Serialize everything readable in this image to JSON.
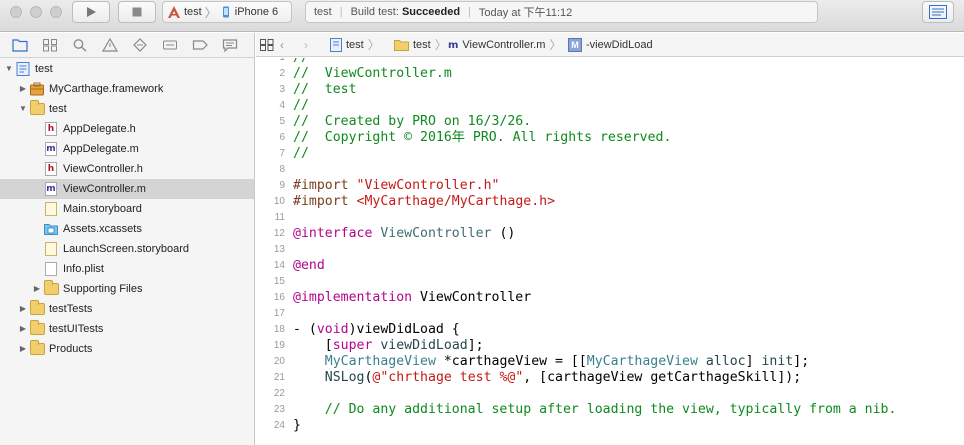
{
  "toolbar": {
    "scheme": {
      "target": "test",
      "device": "iPhone 6"
    },
    "status": {
      "project": "test",
      "build_label": "Build test:",
      "build_result": "Succeeded",
      "time": "Today at 下午11:12"
    }
  },
  "navigator": {
    "tree": [
      {
        "label": "test",
        "kind": "project",
        "depth": 0,
        "disclosure": "open"
      },
      {
        "label": "MyCarthage.framework",
        "kind": "framework",
        "depth": 1,
        "disclosure": "closed"
      },
      {
        "label": "test",
        "kind": "folder",
        "depth": 1,
        "disclosure": "open"
      },
      {
        "label": "AppDelegate.h",
        "kind": "h",
        "depth": 2
      },
      {
        "label": "AppDelegate.m",
        "kind": "m",
        "depth": 2
      },
      {
        "label": "ViewController.h",
        "kind": "h",
        "depth": 2
      },
      {
        "label": "ViewController.m",
        "kind": "m",
        "depth": 2,
        "selected": true
      },
      {
        "label": "Main.storyboard",
        "kind": "storyboard",
        "depth": 2
      },
      {
        "label": "Assets.xcassets",
        "kind": "assets",
        "depth": 2
      },
      {
        "label": "LaunchScreen.storyboard",
        "kind": "storyboard",
        "depth": 2
      },
      {
        "label": "Info.plist",
        "kind": "plist",
        "depth": 2
      },
      {
        "label": "Supporting Files",
        "kind": "folder",
        "depth": 2,
        "disclosure": "closed"
      },
      {
        "label": "testTests",
        "kind": "folder",
        "depth": 1,
        "disclosure": "closed"
      },
      {
        "label": "testUITests",
        "kind": "folder",
        "depth": 1,
        "disclosure": "closed"
      },
      {
        "label": "Products",
        "kind": "folder",
        "depth": 1,
        "disclosure": "closed"
      }
    ]
  },
  "jumpbar": {
    "crumbs": [
      "test",
      "test",
      "ViewController.m",
      "-viewDidLoad"
    ]
  },
  "editor": {
    "lines": [
      {
        "n": "1",
        "parts": [
          [
            "//",
            "cm"
          ]
        ]
      },
      {
        "n": "2",
        "parts": [
          [
            "//  ViewController.m",
            "cm"
          ]
        ]
      },
      {
        "n": "3",
        "parts": [
          [
            "//  test",
            "cm"
          ]
        ]
      },
      {
        "n": "4",
        "parts": [
          [
            "//",
            "cm"
          ]
        ]
      },
      {
        "n": "5",
        "parts": [
          [
            "//  Created by PRO on 16/3/26.",
            "cm"
          ]
        ]
      },
      {
        "n": "6",
        "parts": [
          [
            "//  Copyright © 2016年 PRO. All rights reserved.",
            "cm"
          ]
        ]
      },
      {
        "n": "7",
        "parts": [
          [
            "//",
            "cm"
          ]
        ]
      },
      {
        "n": "8",
        "parts": []
      },
      {
        "n": "9",
        "parts": [
          [
            "#import ",
            "pp"
          ],
          [
            "\"ViewController.h\"",
            "st"
          ]
        ]
      },
      {
        "n": "10",
        "parts": [
          [
            "#import ",
            "pp"
          ],
          [
            "<MyCarthage/MyCarthage.h>",
            "st"
          ]
        ]
      },
      {
        "n": "11",
        "parts": []
      },
      {
        "n": "12",
        "parts": [
          [
            "@interface",
            "kw"
          ],
          [
            " ViewController ",
            "cls"
          ],
          [
            "()",
            ""
          ]
        ]
      },
      {
        "n": "13",
        "parts": []
      },
      {
        "n": "14",
        "parts": [
          [
            "@end",
            "kw"
          ]
        ]
      },
      {
        "n": "15",
        "parts": []
      },
      {
        "n": "16",
        "parts": [
          [
            "@implementation",
            "kw"
          ],
          [
            " ViewController",
            ""
          ]
        ]
      },
      {
        "n": "17",
        "parts": []
      },
      {
        "n": "18",
        "parts": [
          [
            "- (",
            ""
          ],
          [
            "void",
            "kw"
          ],
          [
            ")viewDidLoad {",
            ""
          ]
        ]
      },
      {
        "n": "19",
        "parts": [
          [
            "    [",
            ""
          ],
          [
            "super",
            "kw"
          ],
          [
            " ",
            ""
          ],
          [
            "viewDidLoad",
            "mt"
          ],
          [
            "];",
            ""
          ]
        ]
      },
      {
        "n": "20",
        "parts": [
          [
            "    ",
            ""
          ],
          [
            "MyCarthageView",
            "ty"
          ],
          [
            " *carthageView = [[",
            ""
          ],
          [
            "MyCarthageView",
            "ty"
          ],
          [
            " ",
            ""
          ],
          [
            "alloc",
            "mt"
          ],
          [
            "] ",
            ""
          ],
          [
            "init",
            "mt"
          ],
          [
            "];",
            ""
          ]
        ]
      },
      {
        "n": "21",
        "parts": [
          [
            "    ",
            ""
          ],
          [
            "NSLog",
            "mt"
          ],
          [
            "(",
            ""
          ],
          [
            "@\"chrthage test %@\"",
            "st"
          ],
          [
            ", [carthageView getCarthageSkill]);",
            ""
          ]
        ]
      },
      {
        "n": "22",
        "parts": []
      },
      {
        "n": "23",
        "parts": [
          [
            "    // Do any additional setup after loading the view, typically from a nib.",
            "cm"
          ]
        ]
      },
      {
        "n": "24",
        "parts": [
          [
            "}",
            ""
          ]
        ]
      }
    ]
  }
}
